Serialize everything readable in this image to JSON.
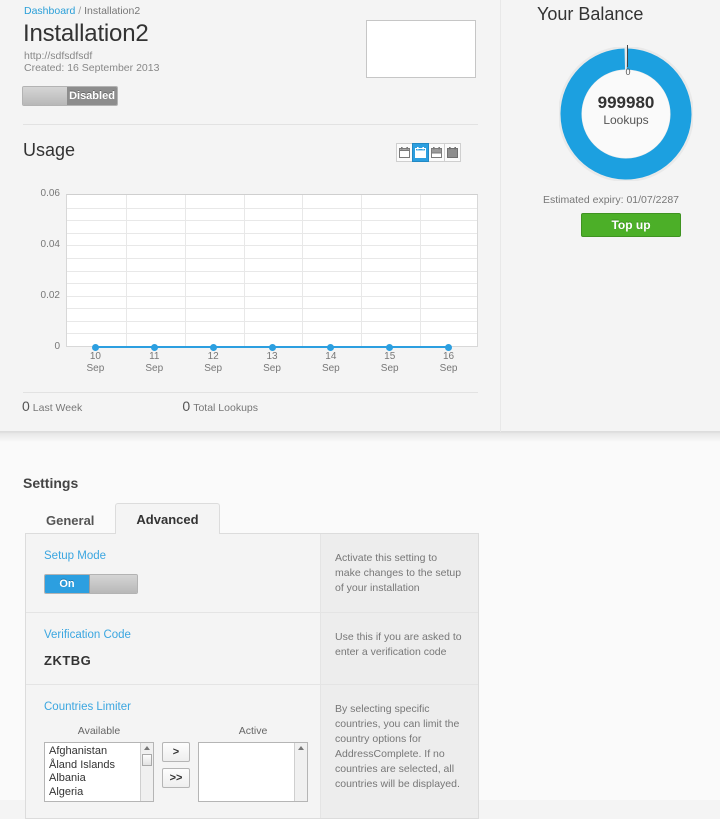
{
  "breadcrumb": {
    "root": "Dashboard",
    "separator": "/",
    "current": "Installation2"
  },
  "header": {
    "title": "Installation2",
    "url": "http://sdfsdfsdf",
    "created": "Created: 16 September 2013",
    "status_toggle": {
      "state": "off",
      "label": "Disabled"
    }
  },
  "usage": {
    "title": "Usage",
    "range_buttons": [
      {
        "icon": "calendar-day-icon",
        "active": false
      },
      {
        "icon": "calendar-week-icon",
        "active": true
      },
      {
        "icon": "calendar-month-icon",
        "active": false
      },
      {
        "icon": "calendar-year-icon",
        "active": false
      }
    ],
    "stats": [
      {
        "value": "0",
        "label": "Last Week"
      },
      {
        "value": "0",
        "label": "Total Lookups"
      }
    ]
  },
  "chart_data": {
    "type": "line",
    "title": "Usage",
    "xlabel": "",
    "ylabel": "",
    "categories": [
      "10 Sep",
      "11 Sep",
      "12 Sep",
      "13 Sep",
      "14 Sep",
      "15 Sep",
      "16 Sep"
    ],
    "x_tick_day": [
      "10",
      "11",
      "12",
      "13",
      "14",
      "15",
      "16"
    ],
    "x_tick_month": [
      "Sep",
      "Sep",
      "Sep",
      "Sep",
      "Sep",
      "Sep",
      "Sep"
    ],
    "values": [
      0,
      0,
      0,
      0,
      0,
      0,
      0
    ],
    "ylim": [
      0,
      0.06
    ],
    "y_ticks": [
      0,
      0.02,
      0.04,
      0.06
    ],
    "y_tick_labels": [
      "0",
      "0.02",
      "0.04",
      "0.06"
    ],
    "y_minor_divisions": 12,
    "grid": true,
    "legend": false,
    "series_color": "#2c9fe0",
    "marker": "circle"
  },
  "balance": {
    "title": "Your Balance",
    "gauge": {
      "type": "donut",
      "start_label": "0",
      "value": 999980,
      "percent_filled": 100,
      "color": "#1ca0e0",
      "track_color": "#e9e9e9"
    },
    "value": "999980",
    "unit": "Lookups",
    "expiry": "Estimated expiry: 01/07/2287",
    "topup_label": "Top up",
    "topup_color": "#4caf28"
  },
  "settings": {
    "title": "Settings",
    "tabs": [
      {
        "label": "General",
        "active": false
      },
      {
        "label": "Advanced",
        "active": true
      }
    ],
    "rows": [
      {
        "label": "Setup Mode",
        "control": "toggle",
        "toggle": {
          "state": "on",
          "label": "On"
        },
        "help": "Activate this setting to make changes to the setup of your installation"
      },
      {
        "label": "Verification Code",
        "control": "text",
        "value": "ZKTBG",
        "help": "Use this if you are asked to enter a verification code"
      },
      {
        "label": "Countries Limiter",
        "control": "dual-list",
        "available_heading": "Available",
        "active_heading": "Active",
        "available_items": [
          "Afghanistan",
          "Åland Islands",
          "Albania",
          "Algeria"
        ],
        "active_items": [],
        "move_one_label": ">",
        "move_all_label": ">>",
        "help": "By selecting specific countries, you can limit the country options for AddressComplete. If no countries are selected, all countries will be displayed."
      }
    ]
  }
}
